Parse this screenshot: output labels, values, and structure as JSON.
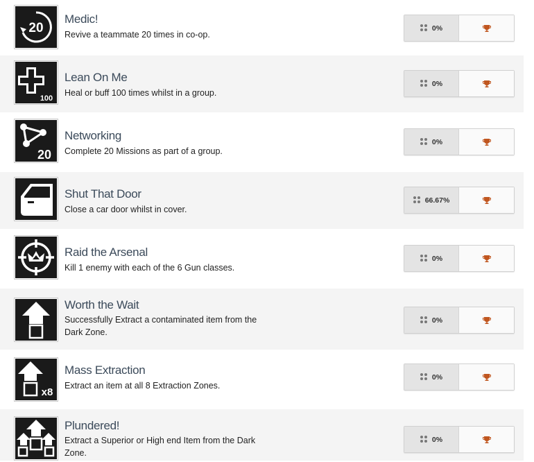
{
  "trophy_color": "#c0561f",
  "achievements": [
    {
      "title": "Medic!",
      "description": "Revive a teammate 20 times in co-op.",
      "percent": "0%",
      "icon": "revive-20-icon"
    },
    {
      "title": "Lean On Me",
      "description": "Heal or buff 100 times whilst in a group.",
      "percent": "0%",
      "icon": "medical-cross-100-icon"
    },
    {
      "title": "Networking",
      "description": "Complete 20 Missions as part of a group.",
      "percent": "0%",
      "icon": "network-20-icon"
    },
    {
      "title": "Shut That Door",
      "description": "Close a car door whilst in cover.",
      "percent": "66.67%",
      "icon": "car-door-icon"
    },
    {
      "title": "Raid the Arsenal",
      "description": "Kill 1 enemy with each of the 6 Gun classes.",
      "percent": "0%",
      "icon": "crosshair-crown-icon"
    },
    {
      "title": "Worth the Wait",
      "description": "Successfully Extract a contaminated item from the Dark Zone.",
      "percent": "0%",
      "icon": "extraction-arrow-icon"
    },
    {
      "title": "Mass Extraction",
      "description": "Extract an item at all 8 Extraction Zones.",
      "percent": "0%",
      "icon": "extraction-x8-icon"
    },
    {
      "title": "Plundered!",
      "description": "Extract a Superior or High end Item from the Dark Zone.",
      "percent": "0%",
      "icon": "triple-extraction-icon"
    }
  ]
}
